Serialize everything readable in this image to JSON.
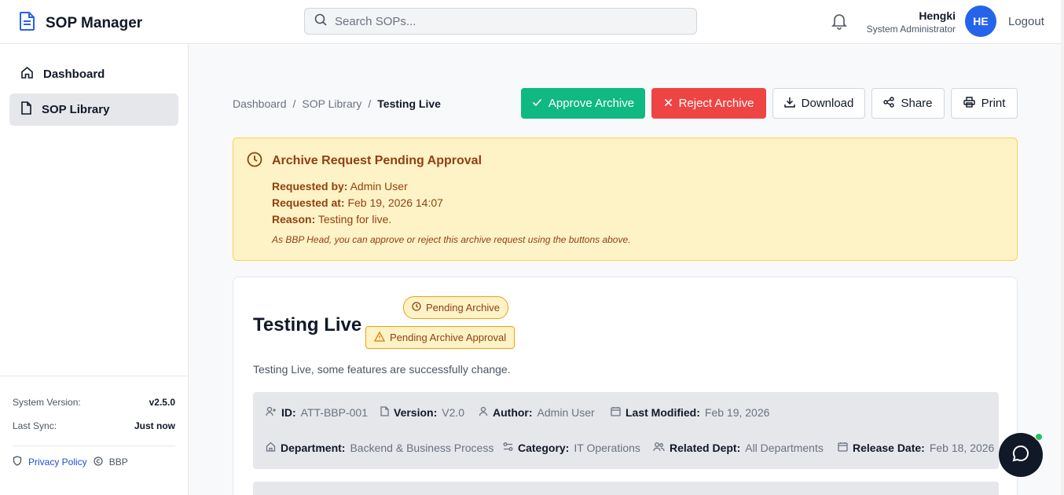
{
  "app": {
    "title": "SOP Manager"
  },
  "search": {
    "placeholder": "Search SOPs..."
  },
  "user": {
    "name": "Hengki",
    "role": "System Administrator",
    "initials": "HE",
    "logout_label": "Logout"
  },
  "sidebar": {
    "items": [
      {
        "label": "Dashboard",
        "icon": "home-icon"
      },
      {
        "label": "SOP Library",
        "icon": "file-icon",
        "active": true
      }
    ],
    "footer": {
      "version_label": "System Version:",
      "version_value": "v2.5.0",
      "sync_label": "Last Sync:",
      "sync_value": "Just now",
      "privacy_label": "Privacy Policy",
      "copyright": "BBP"
    }
  },
  "breadcrumb": {
    "items": [
      "Dashboard",
      "SOP Library"
    ],
    "current": "Testing Live",
    "separator": "/"
  },
  "toolbar": {
    "approve_label": "Approve Archive",
    "reject_label": "Reject Archive",
    "download_label": "Download",
    "share_label": "Share",
    "print_label": "Print"
  },
  "alert": {
    "title": "Archive Request Pending Approval",
    "requested_by_label": "Requested by:",
    "requested_by_value": "Admin User",
    "requested_at_label": "Requested at:",
    "requested_at_value": "Feb 19, 2026 14:07",
    "reason_label": "Reason:",
    "reason_value": "Testing for live.",
    "note": "As BBP Head, you can approve or reject this archive request using the buttons above."
  },
  "document": {
    "title": "Testing Live",
    "badge_status": "Pending Archive",
    "badge_approval": "Pending Archive Approval",
    "description": "Testing Live, some features are successfully change.",
    "meta": {
      "id_label": "ID:",
      "id_value": "ATT-BBP-001",
      "version_label": "Version:",
      "version_value": "V2.0",
      "author_label": "Author:",
      "author_value": "Admin User",
      "modified_label": "Last Modified:",
      "modified_value": "Feb 19, 2026",
      "department_label": "Department:",
      "department_value": "Backend & Business Process",
      "category_label": "Category:",
      "category_value": "IT Operations",
      "related_label": "Related Dept:",
      "related_value": "All Departments",
      "release_label": "Release Date:",
      "release_value": "Feb 18, 2026"
    }
  },
  "colors": {
    "approve": "#10b981",
    "reject": "#ef4444",
    "primary": "#2563eb",
    "warning_bg": "#fef3c7",
    "warning_text": "#92400e"
  }
}
